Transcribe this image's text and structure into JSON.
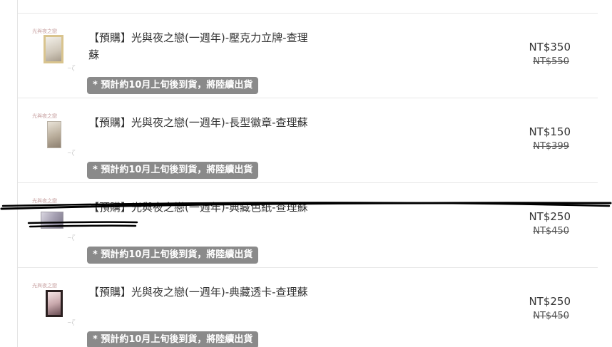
{
  "items": [
    {
      "title": "【預購】光與夜之戀(一週年)-壓克力立牌-查理蘇",
      "badge": "* 預計約10月上旬後到貨，將陸續出貨",
      "price": "NT$350",
      "original_price": "NT$550",
      "thumbnail_brand": "光與夜之戀",
      "thumbnail_icon": "acrylic-stand-image"
    },
    {
      "title": "【預購】光與夜之戀(一週年)-長型徽章-查理蘇",
      "badge": "* 預計約10月上旬後到貨，將陸續出貨",
      "price": "NT$150",
      "original_price": "NT$399",
      "thumbnail_brand": "光與夜之戀",
      "thumbnail_icon": "long-badge-image"
    },
    {
      "title": "【預購】光與夜之戀(一週年)-典藏色紙-查理蘇",
      "badge": "* 預計約10月上旬後到貨，將陸續出貨",
      "price": "NT$250",
      "original_price": "NT$450",
      "thumbnail_brand": "光與夜之戀",
      "thumbnail_icon": "shikishi-image"
    },
    {
      "title": "【預購】光與夜之戀(一週年)-典藏透卡-查理蘇",
      "badge": "* 預計約10月上旬後到貨，將陸續出貨",
      "price": "NT$250",
      "original_price": "NT$450",
      "thumbnail_brand": "光與夜之戀",
      "thumbnail_icon": "transparent-card-image"
    }
  ],
  "colors": {
    "badge_background": "#8a8a8a",
    "divider": "#e8e8e8",
    "text": "#333333",
    "strike_marks": "#000000"
  }
}
